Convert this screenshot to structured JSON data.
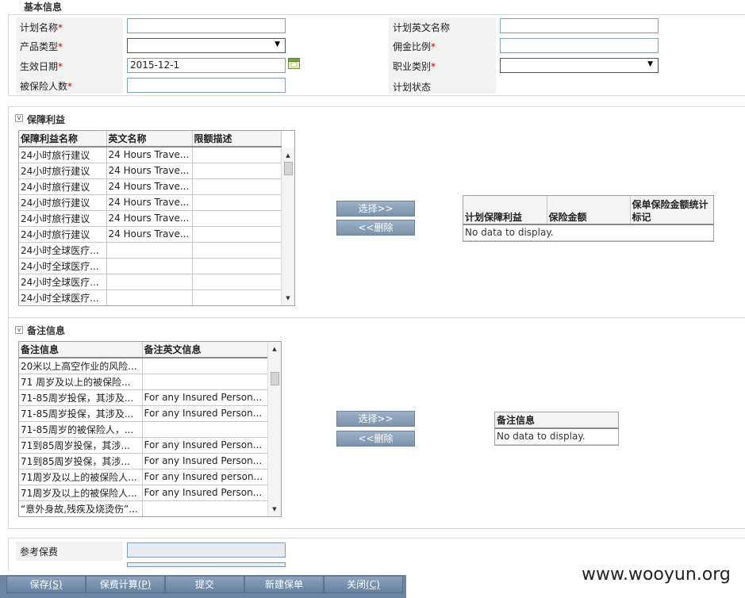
{
  "basic_info": {
    "title": "基本信息",
    "fields": {
      "plan_name": {
        "label": "计划名称",
        "required": "*",
        "value": ""
      },
      "product_type": {
        "label": "产品类型",
        "required": "*",
        "value": ""
      },
      "effective_date": {
        "label": "生效日期",
        "required": "*",
        "value": "2015-12-1"
      },
      "insured_count": {
        "label": "被保险人数",
        "required": "*",
        "value": ""
      },
      "plan_english_name": {
        "label": "计划英文名称",
        "value": ""
      },
      "commission_ratio": {
        "label": "佣金比例",
        "required": "*",
        "value": ""
      },
      "occupation_category": {
        "label": "职业类别",
        "required": "*",
        "value": ""
      },
      "plan_status": {
        "label": "计划状态",
        "value": ""
      }
    }
  },
  "benefits": {
    "title": "保障利益",
    "toggle_glyph": "v",
    "columns": [
      "保障利益名称",
      "英文名称",
      "限额描述"
    ],
    "rows": [
      [
        "24小时旅行建议",
        "24 Hours Trave...",
        ""
      ],
      [
        "24小时旅行建议",
        "24 Hours Trave...",
        ""
      ],
      [
        "24小时旅行建议",
        "24 Hours Trave...",
        ""
      ],
      [
        "24小时旅行建议",
        "24 Hours Trave...",
        ""
      ],
      [
        "24小时旅行建议",
        "24 Hours Trave...",
        ""
      ],
      [
        "24小时旅行建议",
        "24 Hours Trave...",
        ""
      ],
      [
        "24小时全球医疗...",
        "",
        ""
      ],
      [
        "24小时全球医疗...",
        "",
        ""
      ],
      [
        "24小时全球医疗...",
        "",
        ""
      ],
      [
        "24小时全球医疗...",
        "",
        ""
      ]
    ],
    "select_label": "选择>>",
    "delete_label": "<<删除",
    "selected_columns": [
      "计划保障利益",
      "保险金额",
      "保单保险金额统计标记"
    ],
    "empty_text": "No data to display."
  },
  "remarks": {
    "title": "备注信息",
    "toggle_glyph": "v",
    "columns": [
      "备注信息",
      "备注英文信息"
    ],
    "rows": [
      [
        "20米以上高空作业的风险...",
        ""
      ],
      [
        "71 周岁及以上的被保险...",
        ""
      ],
      [
        "71-85周岁投保，其涉及...",
        "For any Insured Person..."
      ],
      [
        "71-85周岁投保，其涉及...",
        "For any Insured Person..."
      ],
      [
        "71-85周岁的被保险人，...",
        ""
      ],
      [
        "71到85周岁投保，其涉...",
        "For any Insured Person..."
      ],
      [
        "71到85周岁投保，其涉...",
        "For any Insured Person..."
      ],
      [
        "71周岁及以上的被保险人...",
        "For any Insured person..."
      ],
      [
        "71周岁及以上的被保险人...",
        "For any Insured Person..."
      ],
      [
        "“意外身故,残疾及烧烫伤”...",
        ""
      ]
    ],
    "select_label": "选择>>",
    "delete_label": "<<删除",
    "selected_columns": [
      "备注信息"
    ],
    "empty_text": "No data to display."
  },
  "premium": {
    "label": "参考保费",
    "value": ""
  },
  "toolbar": {
    "save": "保存",
    "save_key": "(S)",
    "calc": "保费计算",
    "calc_key": "(P)",
    "submit": "提交",
    "new_policy": "新建保单",
    "close": "关闭",
    "close_key": "(C)"
  },
  "icons": {
    "calendar": "calendar-icon",
    "dropdown": "▼",
    "scroll_up": "▲",
    "scroll_down": "▼"
  },
  "colors": {
    "button_bg": "#8299b3",
    "toolbar_bg": "#6b86a4",
    "required": "#cc0000"
  },
  "watermark": "www.wooyun.org"
}
